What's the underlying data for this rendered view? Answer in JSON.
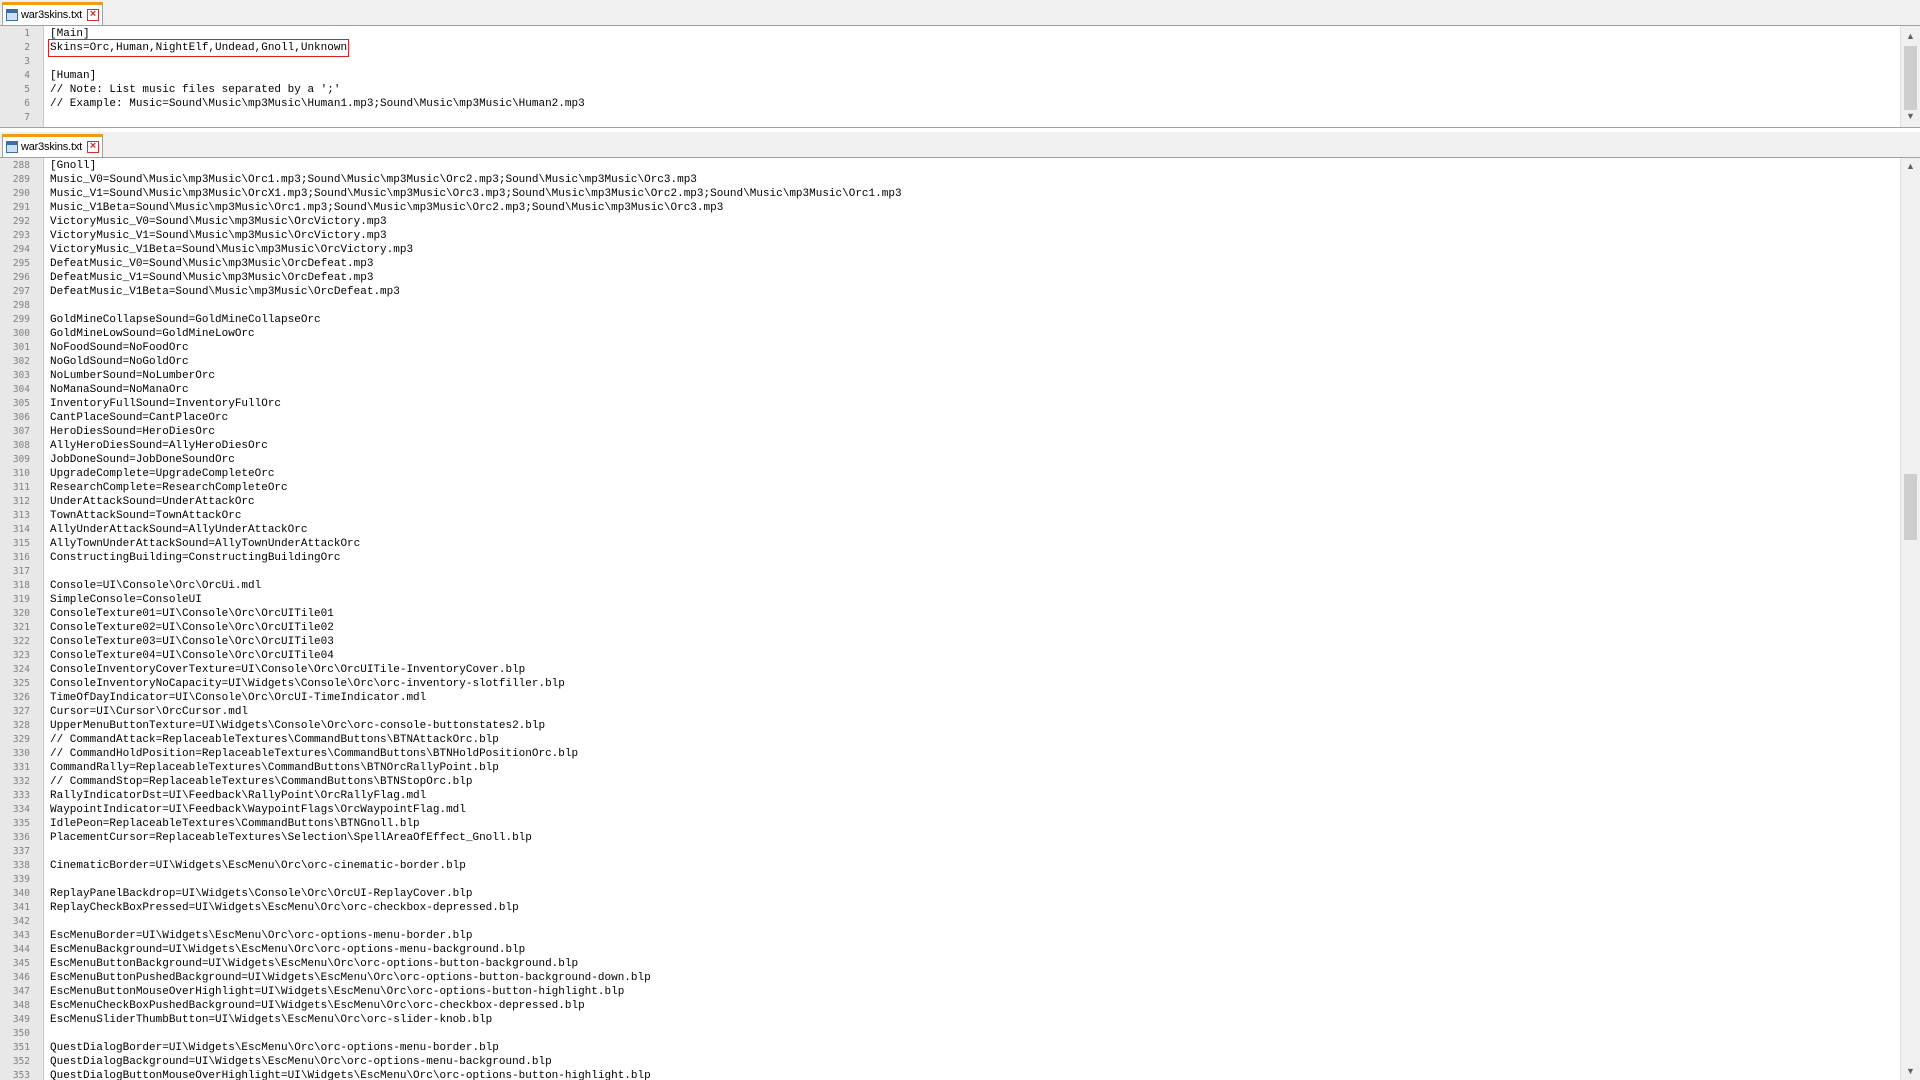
{
  "pane_top": {
    "tab_label": "war3skins.txt",
    "lines": [
      {
        "n": "1",
        "t": "[Main]"
      },
      {
        "n": "2",
        "t": "Skins=Orc,Human,NightElf,Undead,Gnoll,Unknown",
        "hl": true
      },
      {
        "n": "3",
        "t": ""
      },
      {
        "n": "4",
        "t": "[Human]"
      },
      {
        "n": "5",
        "t": "// Note: List music files separated by a ';'"
      },
      {
        "n": "6",
        "t": "// Example: Music=Sound\\Music\\mp3Music\\Human1.mp3;Sound\\Music\\mp3Music\\Human2.mp3"
      },
      {
        "n": "7",
        "t": ""
      }
    ]
  },
  "pane_bottom": {
    "tab_label": "war3skins.txt",
    "lines": [
      {
        "n": "288",
        "t": "[Gnoll]"
      },
      {
        "n": "289",
        "t": "Music_V0=Sound\\Music\\mp3Music\\Orc1.mp3;Sound\\Music\\mp3Music\\Orc2.mp3;Sound\\Music\\mp3Music\\Orc3.mp3"
      },
      {
        "n": "290",
        "t": "Music_V1=Sound\\Music\\mp3Music\\OrcX1.mp3;Sound\\Music\\mp3Music\\Orc3.mp3;Sound\\Music\\mp3Music\\Orc2.mp3;Sound\\Music\\mp3Music\\Orc1.mp3"
      },
      {
        "n": "291",
        "t": "Music_V1Beta=Sound\\Music\\mp3Music\\Orc1.mp3;Sound\\Music\\mp3Music\\Orc2.mp3;Sound\\Music\\mp3Music\\Orc3.mp3"
      },
      {
        "n": "292",
        "t": "VictoryMusic_V0=Sound\\Music\\mp3Music\\OrcVictory.mp3"
      },
      {
        "n": "293",
        "t": "VictoryMusic_V1=Sound\\Music\\mp3Music\\OrcVictory.mp3"
      },
      {
        "n": "294",
        "t": "VictoryMusic_V1Beta=Sound\\Music\\mp3Music\\OrcVictory.mp3"
      },
      {
        "n": "295",
        "t": "DefeatMusic_V0=Sound\\Music\\mp3Music\\OrcDefeat.mp3"
      },
      {
        "n": "296",
        "t": "DefeatMusic_V1=Sound\\Music\\mp3Music\\OrcDefeat.mp3"
      },
      {
        "n": "297",
        "t": "DefeatMusic_V1Beta=Sound\\Music\\mp3Music\\OrcDefeat.mp3"
      },
      {
        "n": "298",
        "t": ""
      },
      {
        "n": "299",
        "t": "GoldMineCollapseSound=GoldMineCollapseOrc"
      },
      {
        "n": "300",
        "t": "GoldMineLowSound=GoldMineLowOrc"
      },
      {
        "n": "301",
        "t": "NoFoodSound=NoFoodOrc"
      },
      {
        "n": "302",
        "t": "NoGoldSound=NoGoldOrc"
      },
      {
        "n": "303",
        "t": "NoLumberSound=NoLumberOrc"
      },
      {
        "n": "304",
        "t": "NoManaSound=NoManaOrc"
      },
      {
        "n": "305",
        "t": "InventoryFullSound=InventoryFullOrc"
      },
      {
        "n": "306",
        "t": "CantPlaceSound=CantPlaceOrc"
      },
      {
        "n": "307",
        "t": "HeroDiesSound=HeroDiesOrc"
      },
      {
        "n": "308",
        "t": "AllyHeroDiesSound=AllyHeroDiesOrc"
      },
      {
        "n": "309",
        "t": "JobDoneSound=JobDoneSoundOrc"
      },
      {
        "n": "310",
        "t": "UpgradeComplete=UpgradeCompleteOrc"
      },
      {
        "n": "311",
        "t": "ResearchComplete=ResearchCompleteOrc"
      },
      {
        "n": "312",
        "t": "UnderAttackSound=UnderAttackOrc"
      },
      {
        "n": "313",
        "t": "TownAttackSound=TownAttackOrc"
      },
      {
        "n": "314",
        "t": "AllyUnderAttackSound=AllyUnderAttackOrc"
      },
      {
        "n": "315",
        "t": "AllyTownUnderAttackSound=AllyTownUnderAttackOrc"
      },
      {
        "n": "316",
        "t": "ConstructingBuilding=ConstructingBuildingOrc"
      },
      {
        "n": "317",
        "t": ""
      },
      {
        "n": "318",
        "t": "Console=UI\\Console\\Orc\\OrcUi.mdl"
      },
      {
        "n": "319",
        "t": "SimpleConsole=ConsoleUI"
      },
      {
        "n": "320",
        "t": "ConsoleTexture01=UI\\Console\\Orc\\OrcUITile01"
      },
      {
        "n": "321",
        "t": "ConsoleTexture02=UI\\Console\\Orc\\OrcUITile02"
      },
      {
        "n": "322",
        "t": "ConsoleTexture03=UI\\Console\\Orc\\OrcUITile03"
      },
      {
        "n": "323",
        "t": "ConsoleTexture04=UI\\Console\\Orc\\OrcUITile04"
      },
      {
        "n": "324",
        "t": "ConsoleInventoryCoverTexture=UI\\Console\\Orc\\OrcUITile-InventoryCover.blp"
      },
      {
        "n": "325",
        "t": "ConsoleInventoryNoCapacity=UI\\Widgets\\Console\\Orc\\orc-inventory-slotfiller.blp"
      },
      {
        "n": "326",
        "t": "TimeOfDayIndicator=UI\\Console\\Orc\\OrcUI-TimeIndicator.mdl"
      },
      {
        "n": "327",
        "t": "Cursor=UI\\Cursor\\OrcCursor.mdl"
      },
      {
        "n": "328",
        "t": "UpperMenuButtonTexture=UI\\Widgets\\Console\\Orc\\orc-console-buttonstates2.blp"
      },
      {
        "n": "329",
        "t": "// CommandAttack=ReplaceableTextures\\CommandButtons\\BTNAttackOrc.blp"
      },
      {
        "n": "330",
        "t": "// CommandHoldPosition=ReplaceableTextures\\CommandButtons\\BTNHoldPositionOrc.blp"
      },
      {
        "n": "331",
        "t": "CommandRally=ReplaceableTextures\\CommandButtons\\BTNOrcRallyPoint.blp"
      },
      {
        "n": "332",
        "t": "// CommandStop=ReplaceableTextures\\CommandButtons\\BTNStopOrc.blp"
      },
      {
        "n": "333",
        "t": "RallyIndicatorDst=UI\\Feedback\\RallyPoint\\OrcRallyFlag.mdl"
      },
      {
        "n": "334",
        "t": "WaypointIndicator=UI\\Feedback\\WaypointFlags\\OrcWaypointFlag.mdl"
      },
      {
        "n": "335",
        "t": "IdlePeon=ReplaceableTextures\\CommandButtons\\BTNGnoll.blp"
      },
      {
        "n": "336",
        "t": "PlacementCursor=ReplaceableTextures\\Selection\\SpellAreaOfEffect_Gnoll.blp"
      },
      {
        "n": "337",
        "t": ""
      },
      {
        "n": "338",
        "t": "CinematicBorder=UI\\Widgets\\EscMenu\\Orc\\orc-cinematic-border.blp"
      },
      {
        "n": "339",
        "t": ""
      },
      {
        "n": "340",
        "t": "ReplayPanelBackdrop=UI\\Widgets\\Console\\Orc\\OrcUI-ReplayCover.blp"
      },
      {
        "n": "341",
        "t": "ReplayCheckBoxPressed=UI\\Widgets\\EscMenu\\Orc\\orc-checkbox-depressed.blp"
      },
      {
        "n": "342",
        "t": ""
      },
      {
        "n": "343",
        "t": "EscMenuBorder=UI\\Widgets\\EscMenu\\Orc\\orc-options-menu-border.blp"
      },
      {
        "n": "344",
        "t": "EscMenuBackground=UI\\Widgets\\EscMenu\\Orc\\orc-options-menu-background.blp"
      },
      {
        "n": "345",
        "t": "EscMenuButtonBackground=UI\\Widgets\\EscMenu\\Orc\\orc-options-button-background.blp"
      },
      {
        "n": "346",
        "t": "EscMenuButtonPushedBackground=UI\\Widgets\\EscMenu\\Orc\\orc-options-button-background-down.blp"
      },
      {
        "n": "347",
        "t": "EscMenuButtonMouseOverHighlight=UI\\Widgets\\EscMenu\\Orc\\orc-options-button-highlight.blp"
      },
      {
        "n": "348",
        "t": "EscMenuCheckBoxPushedBackground=UI\\Widgets\\EscMenu\\Orc\\orc-checkbox-depressed.blp"
      },
      {
        "n": "349",
        "t": "EscMenuSliderThumbButton=UI\\Widgets\\EscMenu\\Orc\\orc-slider-knob.blp"
      },
      {
        "n": "350",
        "t": ""
      },
      {
        "n": "351",
        "t": "QuestDialogBorder=UI\\Widgets\\EscMenu\\Orc\\orc-options-menu-border.blp"
      },
      {
        "n": "352",
        "t": "QuestDialogBackground=UI\\Widgets\\EscMenu\\Orc\\orc-options-menu-background.blp"
      },
      {
        "n": "353",
        "t": "QuestDialogButtonMouseOverHighlight=UI\\Widgets\\EscMenu\\Orc\\orc-options-button-highlight.blp"
      }
    ]
  },
  "icons": {
    "file": "document-icon",
    "close": "close-icon",
    "up": "scroll-up-arrow-icon",
    "down": "scroll-down-arrow-icon"
  },
  "colors": {
    "tab_accent": "#f39c12",
    "gutter": "#e8e8e8",
    "line_number": "#808080",
    "highlight_box": "#e02020",
    "close": "#d32f2f"
  }
}
